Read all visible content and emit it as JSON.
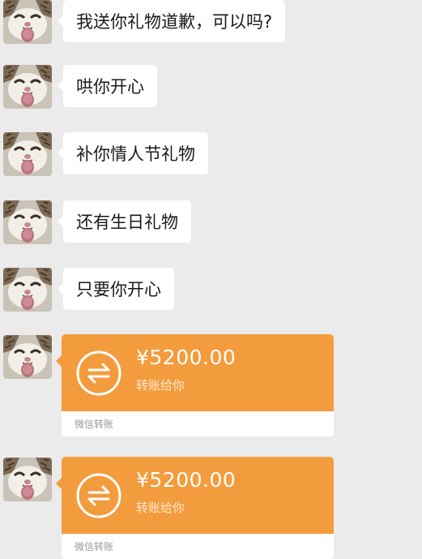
{
  "messages": [
    {
      "text": "我送你礼物道歉，可以吗?"
    },
    {
      "text": "哄你开心"
    },
    {
      "text": "补你情人节礼物"
    },
    {
      "text": "还有生日礼物"
    },
    {
      "text": "只要你开心"
    }
  ],
  "transfers": [
    {
      "amount": "¥5200.00",
      "subtitle": "转账给你",
      "footer": "微信转账"
    },
    {
      "amount": "¥5200.00",
      "subtitle": "转账给你",
      "footer": "微信转账"
    }
  ],
  "colors": {
    "background": "#ebebeb",
    "bubble": "#ffffff",
    "transfer_accent": "#f39c3d"
  },
  "icons": {
    "avatar": "cat-face-avatar",
    "transfer": "transfer-arrows-icon"
  }
}
